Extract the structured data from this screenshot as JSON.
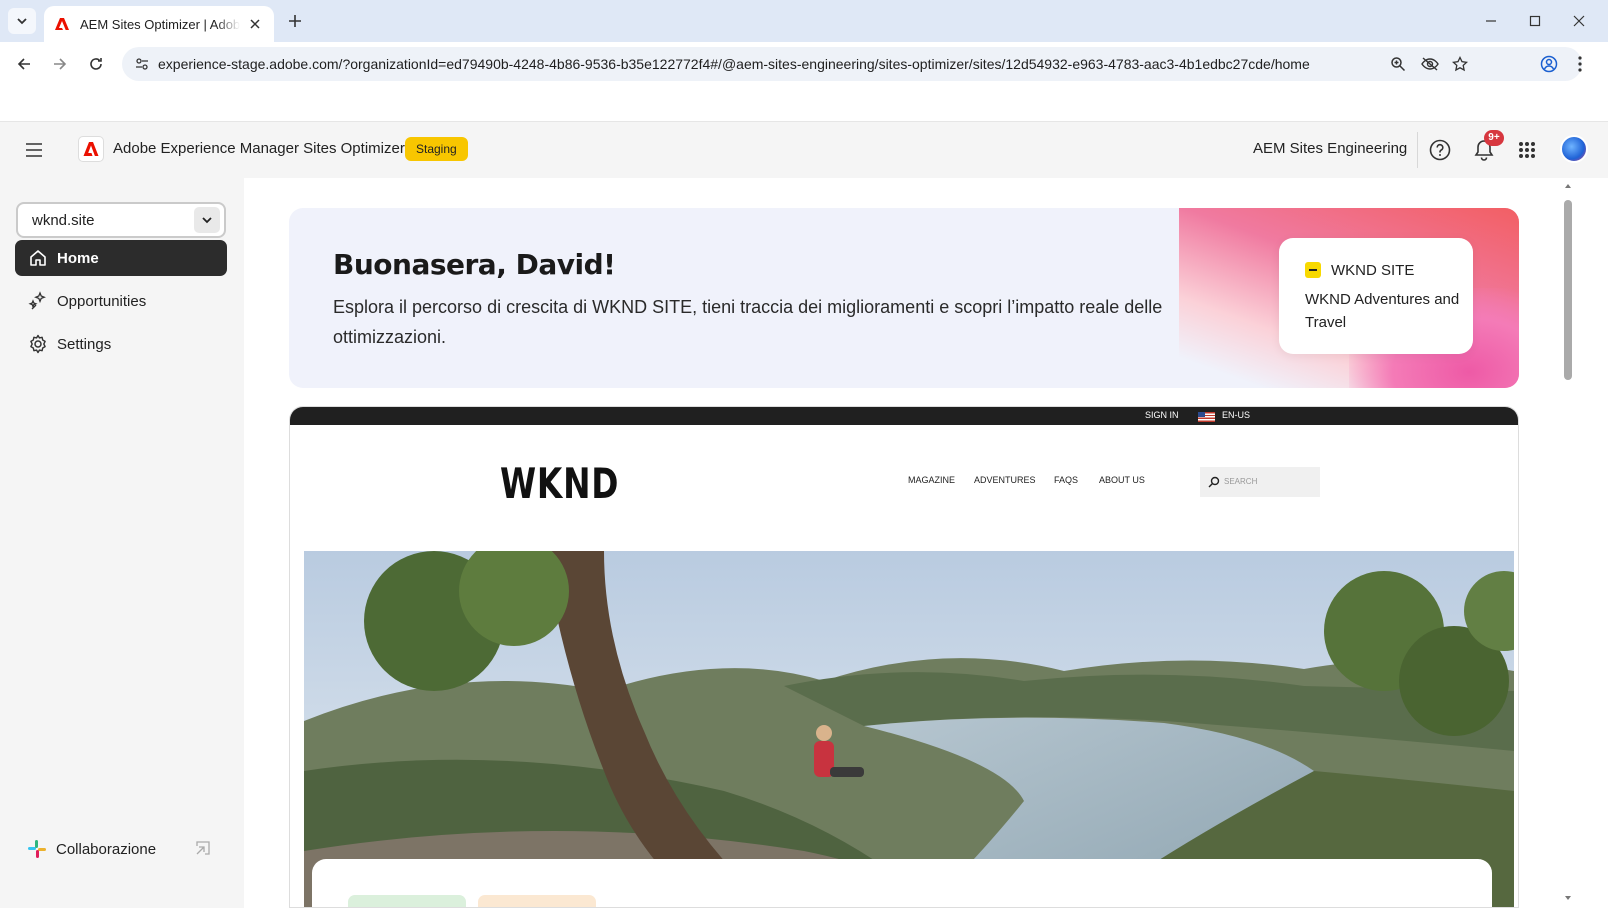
{
  "browser": {
    "tab_title": "AEM Sites Optimizer | Adobe Experience Manager",
    "url": "experience-stage.adobe.com/?organizationId=ed79490b-4248-4b86-9536-b35e122772f4#/@aem-sites-engineering/sites-optimizer/sites/12d54932-e963-4783-aac3-4b1edbc27cde/home"
  },
  "header": {
    "app_title": "Adobe Experience Manager Sites Optimizer",
    "env_badge": "Staging",
    "org_name": "AEM Sites Engineering",
    "notification_count": "9+"
  },
  "sidebar": {
    "site_selector_value": "wknd.site",
    "items": [
      {
        "label": "Home",
        "icon": "home-icon",
        "active": true
      },
      {
        "label": "Opportunities",
        "icon": "sparkle-icon",
        "active": false
      },
      {
        "label": "Settings",
        "icon": "gear-icon",
        "active": false
      }
    ],
    "collaboration_label": "Collaborazione"
  },
  "hero": {
    "greeting": "Buonasera, David!",
    "subtitle": "Esplora il percorso di crescita di WKND SITE, tieni traccia dei miglioramenti e scopri l’impatto reale delle ottimizzazioni.",
    "site_card": {
      "name": "WKND SITE",
      "description": "WKND Adventures and Travel"
    }
  },
  "preview": {
    "sign_in": "SIGN IN",
    "language": "EN-US",
    "logo": "WKND",
    "nav": [
      "MAGAZINE",
      "ADVENTURES",
      "FAQS",
      "ABOUT US"
    ],
    "search_placeholder": "SEARCH"
  },
  "colors": {
    "staging": "#f8c600",
    "active_nav": "#2c2c2c",
    "notification": "#d7373f",
    "adobe_red": "#eb1000"
  }
}
